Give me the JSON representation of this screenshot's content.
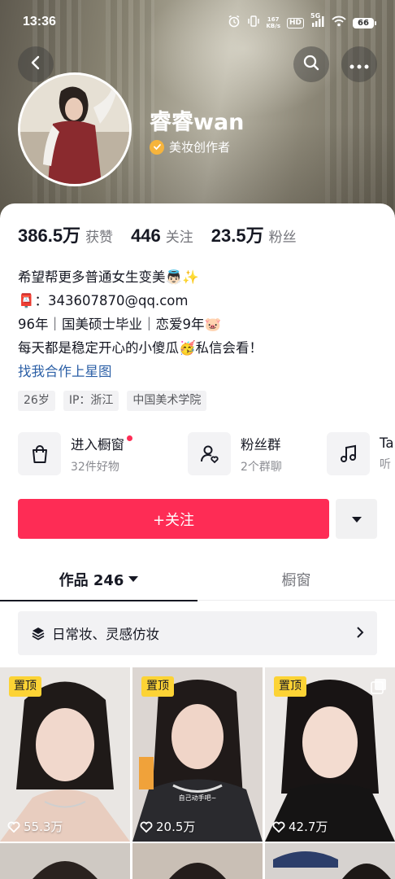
{
  "status_bar": {
    "time": "13:36",
    "net_speed_value": "167",
    "net_speed_unit": "KB/s",
    "hd": "HD",
    "signal_label": "5G",
    "battery": "66"
  },
  "profile": {
    "nickname": "睿睿wan",
    "verify_label": "美妆创作者"
  },
  "stats": [
    {
      "num": "386.5万",
      "label": "获赞"
    },
    {
      "num": "446",
      "label": "关注"
    },
    {
      "num": "23.5万",
      "label": "粉丝"
    }
  ],
  "bio": {
    "line1": "希望帮更多普通女生变美👼🏻✨",
    "line2": "📮：343607870@qq.com",
    "line3": "96年｜国美硕士毕业｜恋爱9年🐷",
    "line4": "每天都是稳定开心的小傻瓜🥳私信会看！",
    "link": "找我合作上星图"
  },
  "tags": [
    "26岁",
    "IP：浙江",
    "中国美术学院"
  ],
  "services": [
    {
      "title": "进入橱窗",
      "subtitle": "32件好物",
      "icon": "shopping-bag-icon"
    },
    {
      "title": "粉丝群",
      "subtitle": "2个群聊",
      "icon": "fan-group-icon"
    },
    {
      "title": "Ta",
      "subtitle": "听",
      "icon": "music-note-icon"
    }
  ],
  "actions": {
    "follow_label": "+关注"
  },
  "tabs": {
    "works_label": "作品 246",
    "shop_label": "橱窗"
  },
  "collection": {
    "label": "日常妆、灵感仿妆"
  },
  "videos": [
    {
      "pinned": "置顶",
      "likes": "55.3万"
    },
    {
      "pinned": "置顶",
      "likes": "20.5万",
      "caption": "自己动手吧~"
    },
    {
      "pinned": "置顶",
      "likes": "42.7万"
    }
  ],
  "colors": {
    "accent": "#fe2c55",
    "pin": "#fcd335",
    "link": "#2b5fa6",
    "verify": "#f6b43c"
  }
}
